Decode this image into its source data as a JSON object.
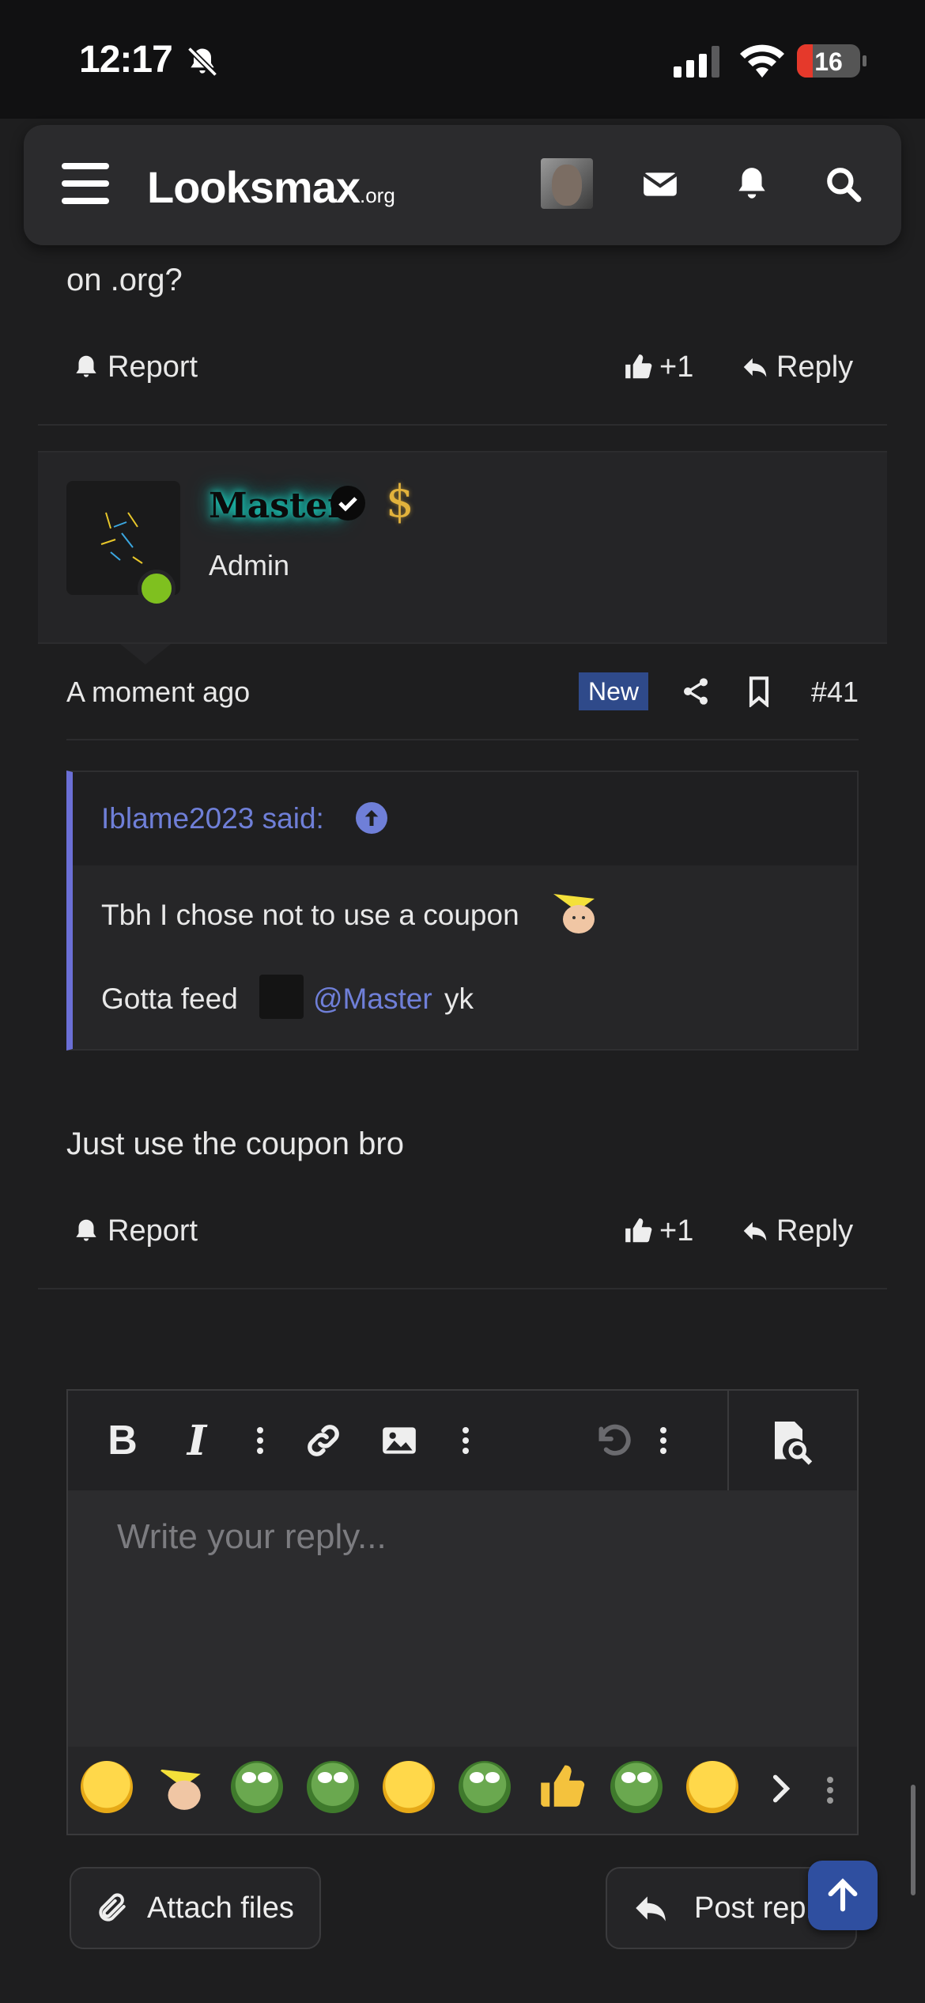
{
  "status_bar": {
    "time": "12:17",
    "battery": "16"
  },
  "header": {
    "logo_main": "Looksmax",
    "logo_suffix": ".org"
  },
  "previous_post": {
    "text_tail": "on .org?",
    "report": "Report",
    "likes": "+1",
    "reply": "Reply"
  },
  "post": {
    "username": "Master",
    "user_title": "Admin",
    "date": "A moment ago",
    "badge": "New",
    "number": "#41",
    "quote": {
      "author": "Iblame2023 said:",
      "line1": "Tbh I chose not to use a coupon",
      "line2_prefix": "Gotta feed",
      "mention": "@Master",
      "line2_suffix": "yk"
    },
    "body": "Just use the coupon bro",
    "report": "Report",
    "likes": "+1",
    "reply": "Reply"
  },
  "editor": {
    "placeholder": "Write your reply...",
    "toolbar": [
      "bold",
      "italic",
      "more-text",
      "link",
      "image",
      "more-insert",
      "undo",
      "more-options",
      "preview"
    ]
  },
  "buttons": {
    "attach": "Attach files",
    "post_reply": "Post reply"
  },
  "colors": {
    "background": "#1e1e1f",
    "accent_link": "#6f7fd8",
    "quote_border": "#6b6fd6",
    "badge_new": "#2f4a8a",
    "online": "#7fc01f",
    "username_glow": "#1fd7c4",
    "dollar_gold": "#e2b23c"
  }
}
